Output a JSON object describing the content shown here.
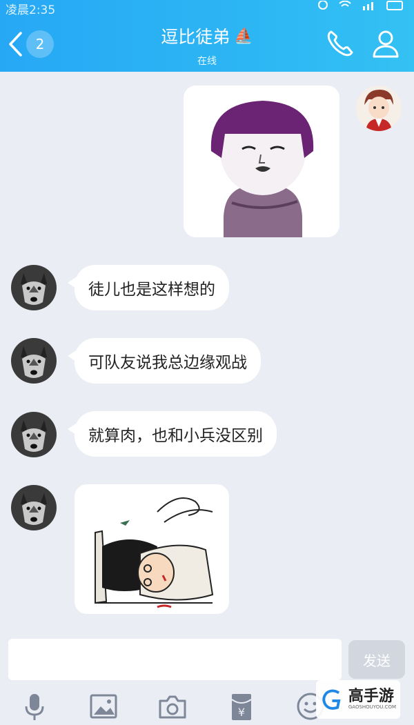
{
  "status_bar": {
    "time": "凌晨2:35"
  },
  "header": {
    "unread_count": "2",
    "title": "逗比徒弟",
    "title_emoji": "⛵",
    "subtitle": "在线"
  },
  "messages": [
    {
      "text": "徒儿也是这样想的"
    },
    {
      "text": "可队友说我总边缘观战"
    },
    {
      "text": "就算肉，也和小兵没区别"
    }
  ],
  "composer": {
    "placeholder": "",
    "send_label": "发送"
  },
  "watermark": {
    "name": "高手游",
    "url": "GAOSHOUYOU.COM"
  },
  "colors": {
    "header": "#2cb6f4",
    "background": "#eaedf4",
    "bubble": "#ffffff"
  }
}
